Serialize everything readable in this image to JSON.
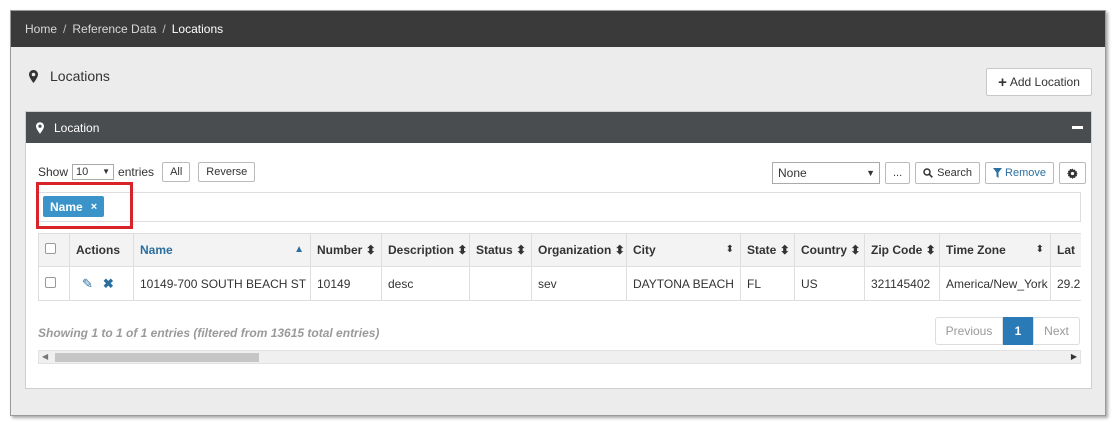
{
  "breadcrumb": {
    "items": [
      "Home",
      "Reference Data"
    ],
    "current": "Locations",
    "separator": "/"
  },
  "page": {
    "title": "Locations",
    "add_button": "Add Location"
  },
  "panel": {
    "title": "Location"
  },
  "controls": {
    "show_label": "Show",
    "length_value": "10",
    "entries_label": "entries",
    "all_button": "All",
    "reverse_button": "Reverse",
    "filter_select": "None",
    "ellipsis_button": "...",
    "search_button": "Search",
    "remove_button": "Remove"
  },
  "chip": {
    "label": "Name",
    "close": "×"
  },
  "table": {
    "headers": [
      "Actions",
      "Name",
      "Number",
      "Description",
      "Status",
      "Organization",
      "City",
      "State",
      "Country",
      "Zip Code",
      "Time Zone",
      "Lat"
    ],
    "rows": [
      {
        "name": "10149-700 SOUTH BEACH ST",
        "number": "10149",
        "description": "desc",
        "status": "",
        "organization": "sev",
        "city": "DAYTONA BEACH",
        "state": "FL",
        "country": "US",
        "zip": "321145402",
        "timezone": "America/New_York",
        "lat": "29.2"
      }
    ]
  },
  "info": "Showing 1 to 1 of 1 entries (filtered from 13615 total entries)",
  "pager": {
    "previous": "Previous",
    "current": "1",
    "next": "Next"
  },
  "colors": {
    "topbar": "#3a3a3a",
    "panel_header": "#4a4d50",
    "chip": "#3b94c9",
    "highlight": "#d9232a",
    "link": "#2a6fa0",
    "active_page": "#2a7ab8"
  }
}
